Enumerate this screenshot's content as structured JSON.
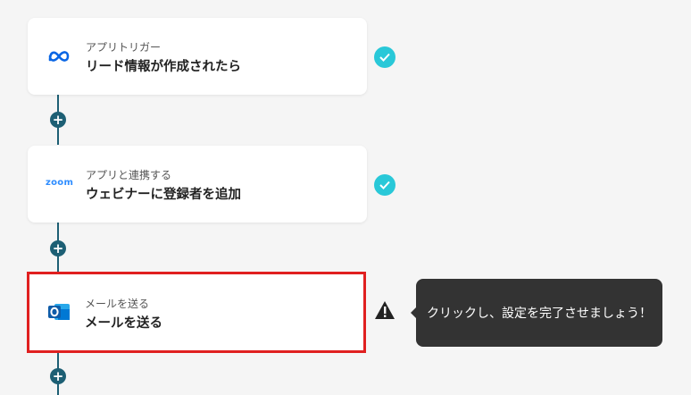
{
  "steps": [
    {
      "subtitle": "アプリトリガー",
      "title": "リード情報が作成されたら",
      "app_icon": "meta-icon",
      "status": "complete"
    },
    {
      "subtitle": "アプリと連携する",
      "title": "ウェビナーに登録者を追加",
      "app_icon": "zoom-icon",
      "app_label": "zoom",
      "status": "complete"
    },
    {
      "subtitle": "メールを送る",
      "title": "メールを送る",
      "app_icon": "outlook-icon",
      "status": "warning"
    }
  ],
  "tooltip": {
    "text": "クリックし、設定を完了させましょう！"
  },
  "add_button_label": "+",
  "colors": {
    "connector": "#1d5f74",
    "check": "#29c8d8",
    "selected_border": "#e02020",
    "tooltip_bg": "#333333"
  }
}
